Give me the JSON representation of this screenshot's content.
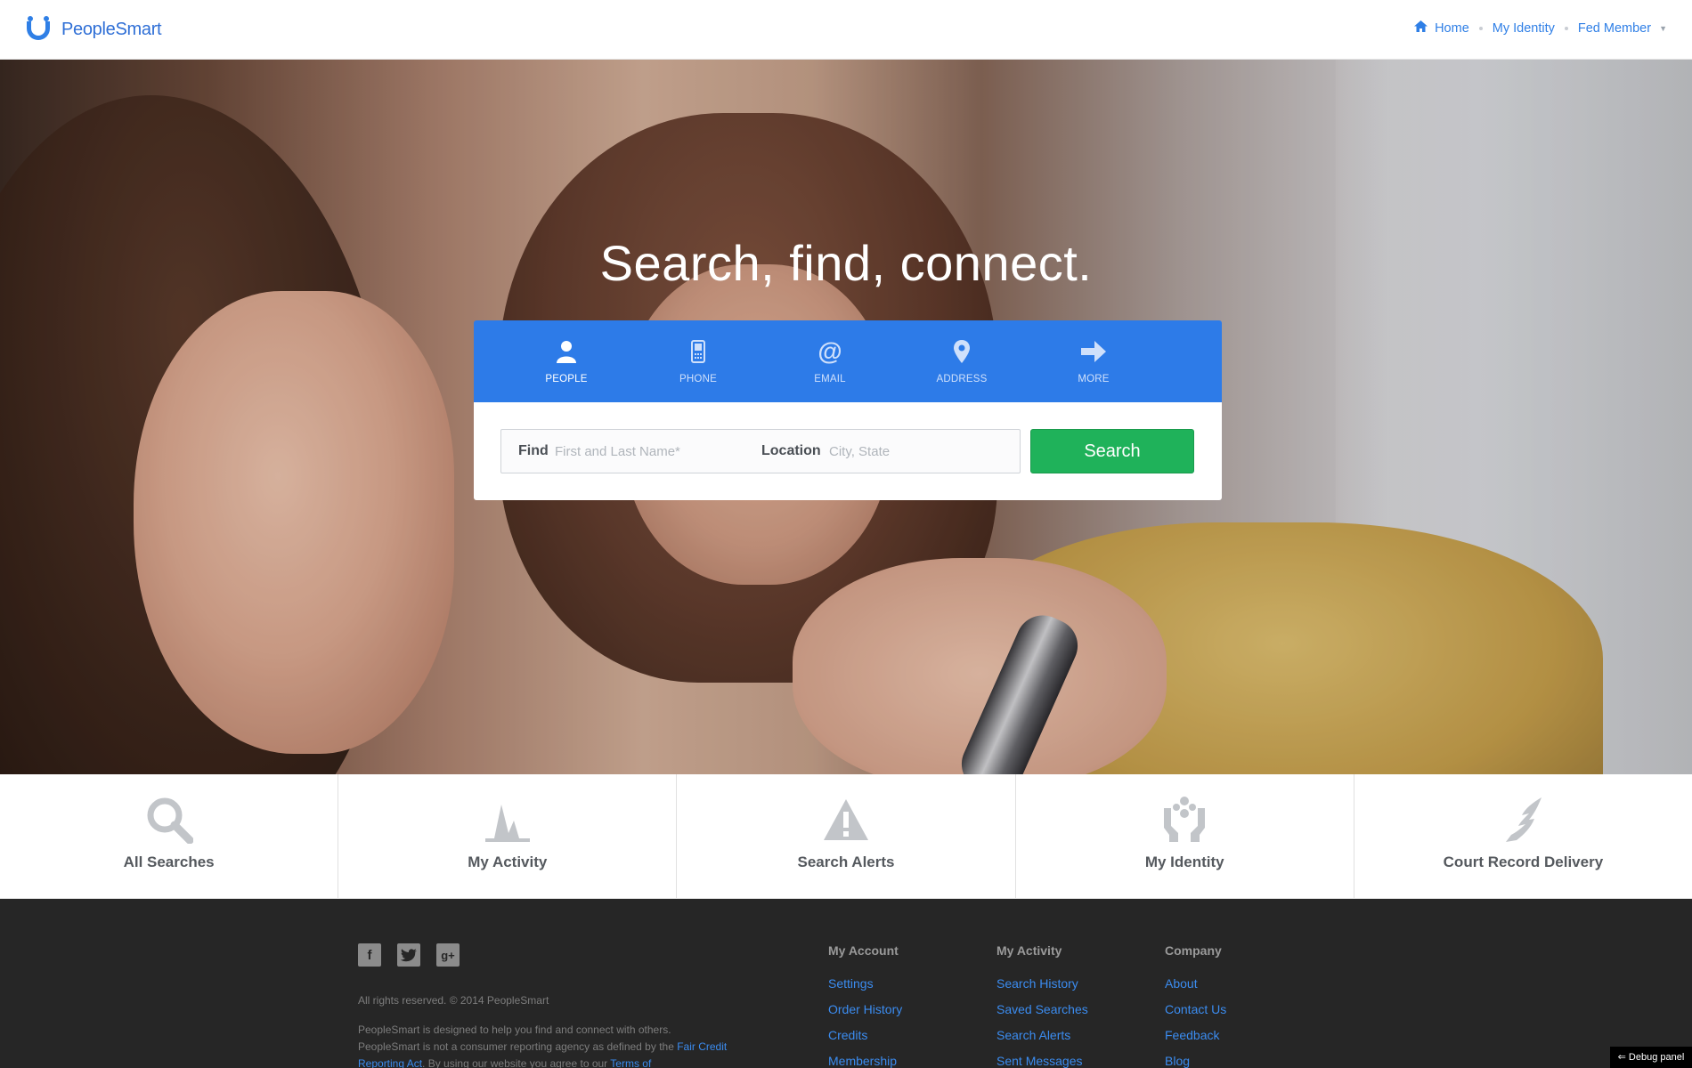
{
  "header": {
    "logo_text": "PeopleSmart",
    "nav": {
      "home": "Home",
      "my_identity": "My Identity",
      "user": "Fed Member"
    }
  },
  "hero": {
    "headline": "Search, find, connect."
  },
  "search": {
    "tabs": [
      {
        "label": "PEOPLE",
        "icon": "person-icon",
        "active": true
      },
      {
        "label": "PHONE",
        "icon": "phone-icon",
        "active": false
      },
      {
        "label": "EMAIL",
        "icon": "at-icon",
        "active": false
      },
      {
        "label": "ADDRESS",
        "icon": "map-pin-icon",
        "active": false
      },
      {
        "label": "MORE",
        "icon": "arrow-right-icon",
        "active": false
      }
    ],
    "find_label": "Find",
    "find_placeholder": "First and Last Name*",
    "location_label": "Location",
    "location_placeholder": "City, State",
    "button_label": "Search"
  },
  "tiles": [
    {
      "label": "All Searches",
      "icon": "magnifier-icon"
    },
    {
      "label": "My Activity",
      "icon": "activity-pulse-icon"
    },
    {
      "label": "Search Alerts",
      "icon": "warning-triangle-icon"
    },
    {
      "label": "My Identity",
      "icon": "identity-hands-icon"
    },
    {
      "label": "Court Record Delivery",
      "icon": "winged-foot-icon"
    }
  ],
  "footer": {
    "social": [
      "facebook-icon",
      "twitter-icon",
      "google-plus-icon"
    ],
    "copyright": "All rights reserved. © 2014 PeopleSmart",
    "legal": {
      "text1": "PeopleSmart is designed to help you find and connect with others. PeopleSmart is not a consumer reporting agency as defined by the ",
      "link1": "Fair Credit Reporting Act",
      "text2": ". By using our website you agree to our ",
      "link2": "Terms of"
    },
    "columns": [
      {
        "heading": "My Account",
        "links": [
          "Settings",
          "Order History",
          "Credits",
          "Membership"
        ]
      },
      {
        "heading": "My Activity",
        "links": [
          "Search History",
          "Saved Searches",
          "Search Alerts",
          "Sent Messages"
        ]
      },
      {
        "heading": "Company",
        "links": [
          "About",
          "Contact Us",
          "Feedback",
          "Blog"
        ]
      }
    ],
    "debug_panel": "⇐ Debug panel"
  },
  "colors": {
    "brand_blue": "#2d7be8",
    "search_green": "#1fb25a",
    "footer_bg": "#262626",
    "link_blue": "#3b8cf0"
  }
}
